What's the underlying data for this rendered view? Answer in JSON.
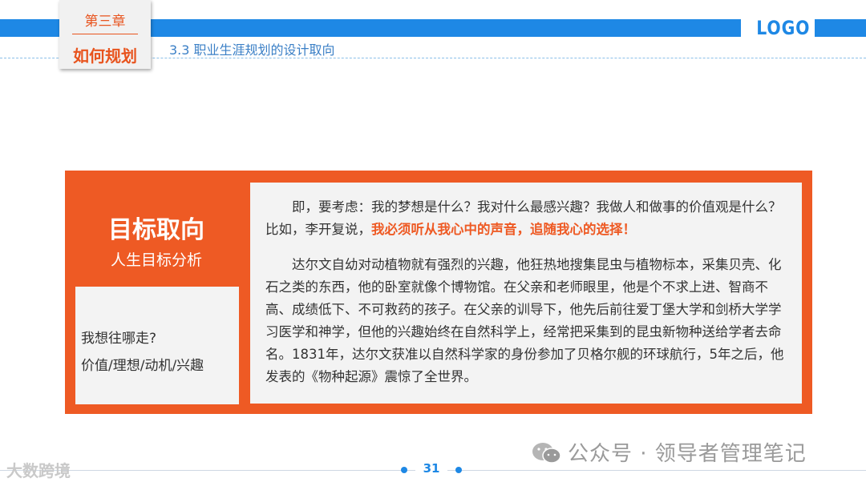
{
  "header": {
    "chapter_number": "第三章",
    "chapter_title": "如何规划",
    "section_title": "3.3 职业生涯规划的设计取向",
    "logo_text": "LOGO"
  },
  "card": {
    "title": "目标取向",
    "subtitle": "人生目标分析",
    "side_lines": [
      "我想往哪走?",
      "价值/理想/动机/兴趣"
    ],
    "para1_text": "即，要考虑：我的梦想是什么？我对什么最感兴趣？我做人和做事的价值观是什么？比如，李开复说，",
    "para1_highlight": "我必须听从我心中的声音，追随我心的选择！",
    "para2_text": "达尔文自幼对动植物就有强烈的兴趣，他狂热地搜集昆虫与植物标本，采集贝壳、化石之类的东西，他的卧室就像个博物馆。在父亲和老师眼里，他是个不求上进、智商不高、成绩低下、不可救药的孩子。在父亲的训导下，他先后前往爱丁堡大学和剑桥大学学习医学和神学，但他的兴趣始终在自然科学上，经常把采集到的昆虫新物种送给学者去命名。1831年，达尔文获准以自然科学家的身份参加了贝格尔舰的环球航行，5年之后，他发表的《物种起源》震惊了全世界。"
  },
  "footer": {
    "page_number": "31",
    "watermark": "公众号 · 领导者管理笔记",
    "source_mark": "大数跨境"
  },
  "colors": {
    "accent_blue": "#1e88e5",
    "accent_orange": "#ee5a24"
  }
}
